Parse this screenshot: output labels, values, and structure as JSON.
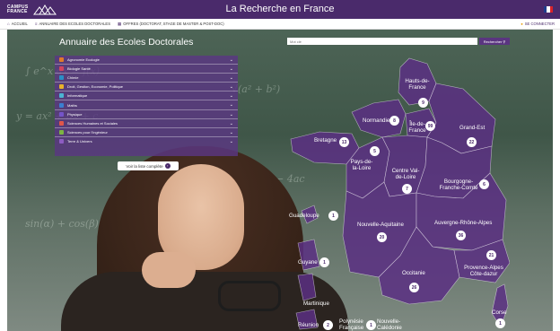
{
  "header": {
    "logo_text": "CAMPUS FRANCE",
    "site_title": "La Recherche en France",
    "flag_colors": [
      "#1f3c8c",
      "#ffffff",
      "#d8232a"
    ]
  },
  "nav": {
    "items": [
      {
        "label": "ACCUEIL",
        "icon": "home-icon"
      },
      {
        "label": "ANNUAIRE DES ECOLES DOCTORALES",
        "icon": "list-icon"
      },
      {
        "label": "OFFRES (DOCTORAT, STAGE DE MASTER & POST-DOC)",
        "icon": "grid-icon"
      }
    ],
    "login_label": "SE CONNECTER",
    "login_icon": "user-icon"
  },
  "main": {
    "title": "Annuaire des Ecoles Doctorales",
    "search": {
      "placeholder": "Mot clé",
      "button_label": "Rechercher"
    },
    "domains": [
      {
        "label": "Agronomie Ecologie",
        "color": "#e07b2a"
      },
      {
        "label": "Biologie Santé",
        "color": "#d2435e"
      },
      {
        "label": "Chimie",
        "color": "#2a8fc6"
      },
      {
        "label": "Droit, Gestion, Economie, Politique",
        "color": "#e8b22a"
      },
      {
        "label": "Informatique",
        "color": "#4bb3d1"
      },
      {
        "label": "Maths",
        "color": "#3b7fd0"
      },
      {
        "label": "Physique",
        "color": "#7454c8"
      },
      {
        "label": "Sciences Humaines et Sociales",
        "color": "#e0564a"
      },
      {
        "label": "Sciences pour l'Ingénieur",
        "color": "#7cb342"
      },
      {
        "label": "Terre & Univers",
        "color": "#8d5cc2"
      }
    ],
    "see_all_label": "Voir la liste complète"
  },
  "map": {
    "fill": "#5b2f82",
    "regions": [
      {
        "name": "Hauts-de-France",
        "count": "9"
      },
      {
        "name": "Normandie",
        "count": "8"
      },
      {
        "name": "Île-de-France",
        "count": "99"
      },
      {
        "name": "Grand-Est",
        "count": "22"
      },
      {
        "name": "Bretagne",
        "count": "13"
      },
      {
        "name": "Pays-de-la-Loire",
        "count": "5"
      },
      {
        "name": "Centre Val-de-Loire",
        "count": "7"
      },
      {
        "name": "Bourgogne-Franche-Comté",
        "count": "6"
      },
      {
        "name": "Nouvelle-Aquitaine",
        "count": "20"
      },
      {
        "name": "Auvergne-Rhône-Alpes",
        "count": "36"
      },
      {
        "name": "Occitanie",
        "count": "26"
      },
      {
        "name": "Provence-Alpes Côte-dazur",
        "count": "21"
      },
      {
        "name": "Corse",
        "count": "1"
      }
    ],
    "overseas": [
      {
        "name": "Guadeloupe",
        "count": "1"
      },
      {
        "name": "Guyane",
        "count": "1"
      },
      {
        "name": "Martinique",
        "count": ""
      },
      {
        "name": "Réunion",
        "count": "2"
      },
      {
        "name": "Polynésie Française",
        "count": ""
      },
      {
        "name": "Nouvelle-Calédonie",
        "count": "1"
      }
    ]
  }
}
